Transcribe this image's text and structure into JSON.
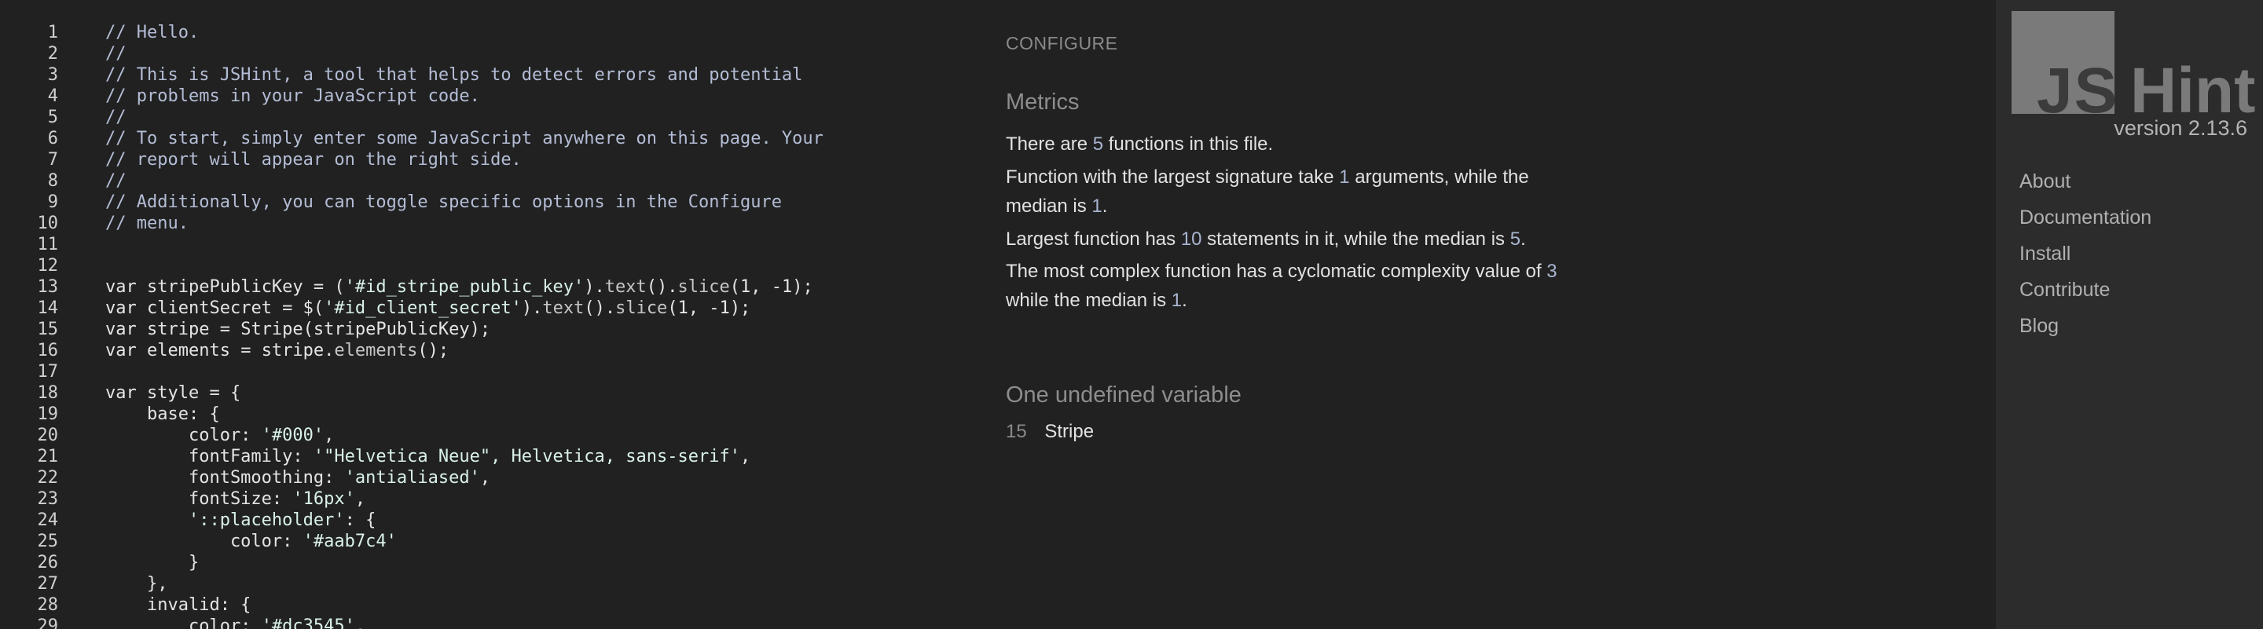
{
  "editor": {
    "lines": [
      {
        "n": "1",
        "t": [
          [
            "// Hello.",
            "comment"
          ]
        ]
      },
      {
        "n": "2",
        "t": [
          [
            "//",
            "comment"
          ]
        ]
      },
      {
        "n": "3",
        "t": [
          [
            "// This is JSHint, a tool that helps to detect errors and potential",
            "comment"
          ]
        ]
      },
      {
        "n": "4",
        "t": [
          [
            "// problems in your JavaScript code.",
            "comment"
          ]
        ]
      },
      {
        "n": "5",
        "t": [
          [
            "//",
            "comment"
          ]
        ]
      },
      {
        "n": "6",
        "t": [
          [
            "// To start, simply enter some JavaScript anywhere on this page. Your",
            "comment"
          ]
        ]
      },
      {
        "n": "7",
        "t": [
          [
            "// report will appear on the right side.",
            "comment"
          ]
        ]
      },
      {
        "n": "8",
        "t": [
          [
            "//",
            "comment"
          ]
        ]
      },
      {
        "n": "9",
        "t": [
          [
            "// Additionally, you can toggle specific options in the Configure",
            "comment"
          ]
        ]
      },
      {
        "n": "10",
        "t": [
          [
            "// menu.",
            "comment"
          ]
        ]
      },
      {
        "n": "11",
        "t": []
      },
      {
        "n": "12",
        "t": []
      },
      {
        "n": "13",
        "t": [
          [
            "var",
            "keyword"
          ],
          [
            " stripePublicKey = (",
            "plain"
          ],
          [
            "'#id_stripe_public_key'",
            "string"
          ],
          [
            ").",
            "plain"
          ],
          [
            "text",
            "method"
          ],
          [
            "().",
            "plain"
          ],
          [
            "slice",
            "method"
          ],
          [
            "(",
            "plain"
          ],
          [
            "1",
            "number"
          ],
          [
            ", -",
            "plain"
          ],
          [
            "1",
            "number"
          ],
          [
            ");",
            "plain"
          ]
        ]
      },
      {
        "n": "14",
        "t": [
          [
            "var",
            "keyword"
          ],
          [
            " clientSecret = $(",
            "plain"
          ],
          [
            "'#id_client_secret'",
            "string"
          ],
          [
            ").",
            "plain"
          ],
          [
            "text",
            "method"
          ],
          [
            "().",
            "plain"
          ],
          [
            "slice",
            "method"
          ],
          [
            "(",
            "plain"
          ],
          [
            "1",
            "number"
          ],
          [
            ", -",
            "plain"
          ],
          [
            "1",
            "number"
          ],
          [
            ");",
            "plain"
          ]
        ]
      },
      {
        "n": "15",
        "t": [
          [
            "var",
            "keyword"
          ],
          [
            " stripe = Stripe(stripePublicKey);",
            "plain"
          ]
        ]
      },
      {
        "n": "16",
        "t": [
          [
            "var",
            "keyword"
          ],
          [
            " elements = stripe.",
            "plain"
          ],
          [
            "elements",
            "method"
          ],
          [
            "();",
            "plain"
          ]
        ]
      },
      {
        "n": "17",
        "t": []
      },
      {
        "n": "18",
        "t": [
          [
            "var",
            "keyword"
          ],
          [
            " style = {",
            "plain"
          ]
        ]
      },
      {
        "n": "19",
        "t": [
          [
            "    base: {",
            "plain"
          ]
        ]
      },
      {
        "n": "20",
        "t": [
          [
            "        color: ",
            "plain"
          ],
          [
            "'#000'",
            "string"
          ],
          [
            ",",
            "plain"
          ]
        ]
      },
      {
        "n": "21",
        "t": [
          [
            "        fontFamily: ",
            "plain"
          ],
          [
            "'\"Helvetica Neue\", Helvetica, sans-serif'",
            "string"
          ],
          [
            ",",
            "plain"
          ]
        ]
      },
      {
        "n": "22",
        "t": [
          [
            "        fontSmoothing: ",
            "plain"
          ],
          [
            "'antialiased'",
            "string"
          ],
          [
            ",",
            "plain"
          ]
        ]
      },
      {
        "n": "23",
        "t": [
          [
            "        fontSize: ",
            "plain"
          ],
          [
            "'16px'",
            "string"
          ],
          [
            ",",
            "plain"
          ]
        ]
      },
      {
        "n": "24",
        "t": [
          [
            "        ",
            "plain"
          ],
          [
            "'::placeholder'",
            "string"
          ],
          [
            ": {",
            "plain"
          ]
        ]
      },
      {
        "n": "25",
        "t": [
          [
            "            color: ",
            "plain"
          ],
          [
            "'#aab7c4'",
            "string"
          ]
        ]
      },
      {
        "n": "26",
        "t": [
          [
            "        }",
            "plain"
          ]
        ]
      },
      {
        "n": "27",
        "t": [
          [
            "    },",
            "plain"
          ]
        ]
      },
      {
        "n": "28",
        "t": [
          [
            "    invalid: {",
            "plain"
          ]
        ]
      },
      {
        "n": "29",
        "t": [
          [
            "        color: ",
            "plain"
          ],
          [
            "'#dc3545'",
            "string"
          ],
          [
            ",",
            "plain"
          ]
        ]
      }
    ]
  },
  "report": {
    "configure_label": "CONFIGURE",
    "metrics_title": "Metrics",
    "metrics": [
      [
        [
          "There are ",
          "t"
        ],
        [
          "5",
          "n"
        ],
        [
          " functions in this file.",
          "t"
        ]
      ],
      [
        [
          "Function with the largest signature take ",
          "t"
        ],
        [
          "1",
          "n"
        ],
        [
          " arguments, while the median is ",
          "t"
        ],
        [
          "1",
          "n"
        ],
        [
          ".",
          "t"
        ]
      ],
      [
        [
          "Largest function has ",
          "t"
        ],
        [
          "10",
          "n"
        ],
        [
          " statements in it, while the median is ",
          "t"
        ],
        [
          "5",
          "n"
        ],
        [
          ".",
          "t"
        ]
      ],
      [
        [
          "The most complex function has a cyclomatic complexity value of ",
          "t"
        ],
        [
          "3",
          "n"
        ],
        [
          " while the median is ",
          "t"
        ],
        [
          "1",
          "n"
        ],
        [
          ".",
          "t"
        ]
      ]
    ],
    "undefined_title": "One undefined variable",
    "undefined_vars": [
      {
        "line": "15",
        "name": "Stripe"
      }
    ]
  },
  "sidebar": {
    "logo_js": "JS",
    "logo_hint": "Hint",
    "version": "version 2.13.6",
    "links": [
      "About",
      "Documentation",
      "Install",
      "Contribute",
      "Blog"
    ]
  }
}
